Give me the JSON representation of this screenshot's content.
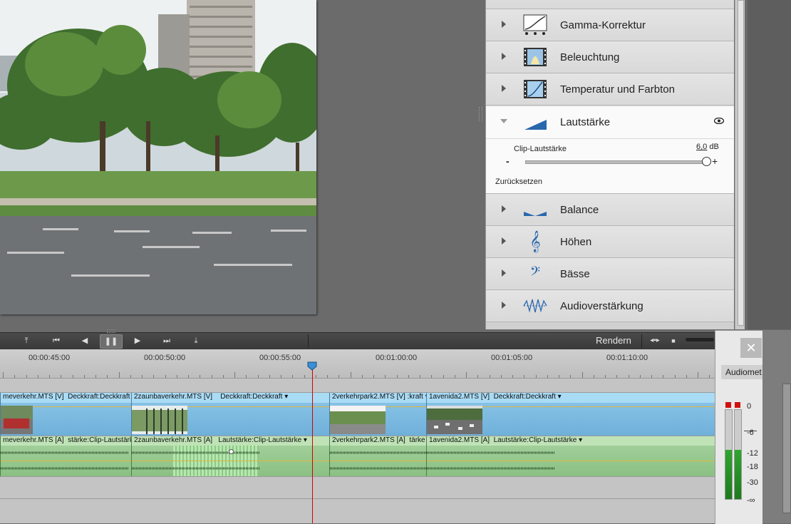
{
  "effects": [
    {
      "label": "Gamma-Korrektur",
      "icon": "gamma-curve-icon"
    },
    {
      "label": "Beleuchtung",
      "icon": "lighting-film-icon"
    },
    {
      "label": "Temperatur und Farbton",
      "icon": "temperature-film-icon"
    },
    {
      "label": "Lautstärke",
      "icon": "volume-ramp-icon",
      "expanded": true
    },
    {
      "label": "Balance",
      "icon": "balance-icon"
    },
    {
      "label": "Höhen",
      "icon": "treble-clef-icon"
    },
    {
      "label": "Bässe",
      "icon": "bass-clef-icon"
    },
    {
      "label": "Audioverstärkung",
      "icon": "audio-gain-icon"
    }
  ],
  "volume": {
    "param_label": "Clip-Lautstärke",
    "value": "6,0",
    "unit": "dB",
    "minus": "-",
    "plus": "+",
    "reset": "Zurücksetzen",
    "slider_fraction": 1.0
  },
  "transport": {
    "render": "Rendern"
  },
  "ruler": {
    "timecodes": [
      "00:00:45:00",
      "00:00:50:00",
      "00:00:55:00",
      "00:01:00:00",
      "00:01:05:00",
      "00:01:10:00"
    ]
  },
  "clips": {
    "video": [
      {
        "name": "meverkehr.MTS [V]",
        "prop": "Deckkraft:Deckkraft ▾"
      },
      {
        "name": "2zaunbaverkehr.MTS [V]",
        "prop": "Deckkraft:Deckkraft ▾"
      },
      {
        "name": "2verkehrpark2.MTS [V]",
        "prop": ":kraft ▾"
      },
      {
        "name": "1avenida2.MTS [V]",
        "prop": "Deckkraft:Deckkraft ▾"
      }
    ],
    "audio": [
      {
        "name": "meverkehr.MTS [A]",
        "prop": "stärke:Clip-Lautstärke ▾"
      },
      {
        "name": "2zaunbaverkehr.MTS [A]",
        "prop": "Lautstärke:Clip-Lautstärke ▾"
      },
      {
        "name": "2verkehrpark2.MTS [A]",
        "prop": "tärke ▾"
      },
      {
        "name": "1avenida2.MTS [A]",
        "prop": "Lautstärke:Clip-Lautstärke ▾"
      }
    ]
  },
  "meter": {
    "close": "✕",
    "title": "Audiomet",
    "scale": [
      "0",
      "-6",
      "-12",
      "-18",
      "-30",
      "-∞"
    ],
    "level_fraction": 0.55
  },
  "colors": {
    "video_clip": "#8ec7e8",
    "audio_clip": "#a7d3a0",
    "playhead": "#d40000",
    "meter_green": "#2fa52f"
  }
}
